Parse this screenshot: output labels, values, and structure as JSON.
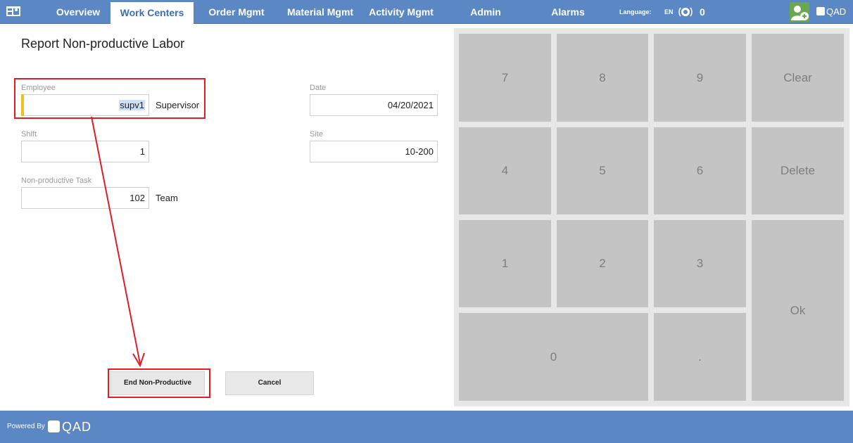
{
  "nav": {
    "tabs": [
      {
        "label": "Overview"
      },
      {
        "label": "Work Centers"
      },
      {
        "label": "Order Mgmt"
      },
      {
        "label": "Material Mgmt"
      },
      {
        "label": "Activity Mgmt"
      },
      {
        "label": "Admin"
      },
      {
        "label": "Alarms"
      }
    ],
    "active_tab": "Work Centers",
    "language_label": "Language:",
    "language_value": "EN",
    "alarm_count": "0",
    "brand": "QAD"
  },
  "form": {
    "title": "Report Non-productive Labor",
    "employee": {
      "label": "Employee",
      "value": "supv1",
      "description": "Supervisor"
    },
    "date": {
      "label": "Date",
      "value": "04/20/2021"
    },
    "shift": {
      "label": "Shift",
      "value": "1"
    },
    "site": {
      "label": "Site",
      "value": "10-200"
    },
    "task": {
      "label": "Non-productive Task",
      "value": "102",
      "description": "Team"
    },
    "end_button": "End Non-Productive",
    "cancel_button": "Cancel"
  },
  "keypad": {
    "keys": [
      "7",
      "8",
      "9",
      "Clear",
      "4",
      "5",
      "6",
      "Delete",
      "1",
      "2",
      "3",
      "Ok",
      "0",
      "."
    ]
  },
  "footer": {
    "powered_by": "Powered By",
    "brand": "QAD"
  },
  "colors": {
    "nav_bg": "#5b87c5",
    "key_bg": "#c4c4c4",
    "annotation": "#e01d24",
    "focus": "#f0c020"
  }
}
